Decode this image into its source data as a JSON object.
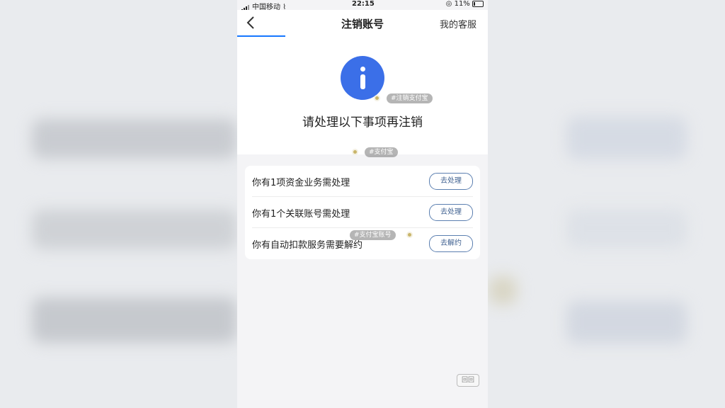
{
  "status_bar": {
    "carrier": "中国移动",
    "time": "22:15",
    "battery": "11%"
  },
  "nav": {
    "back_icon": "chevron-left-icon",
    "title": "注销账号",
    "service_label": "我的客服"
  },
  "hero": {
    "icon": "info-icon",
    "title": "请处理以下事项再注销"
  },
  "tags": [
    "#注销支付宝",
    "#支付宝",
    "#支付宝账号"
  ],
  "items": [
    {
      "text": "你有1项资金业务需处理",
      "action": "去处理"
    },
    {
      "text": "你有1个关联账号需处理",
      "action": "去处理"
    },
    {
      "text": "你有自动扣款服务需要解约",
      "action": "去解约"
    }
  ],
  "corner": {
    "button": "回回"
  },
  "colors": {
    "accent": "#3b6fe8",
    "button_border": "#5b7fb0"
  }
}
